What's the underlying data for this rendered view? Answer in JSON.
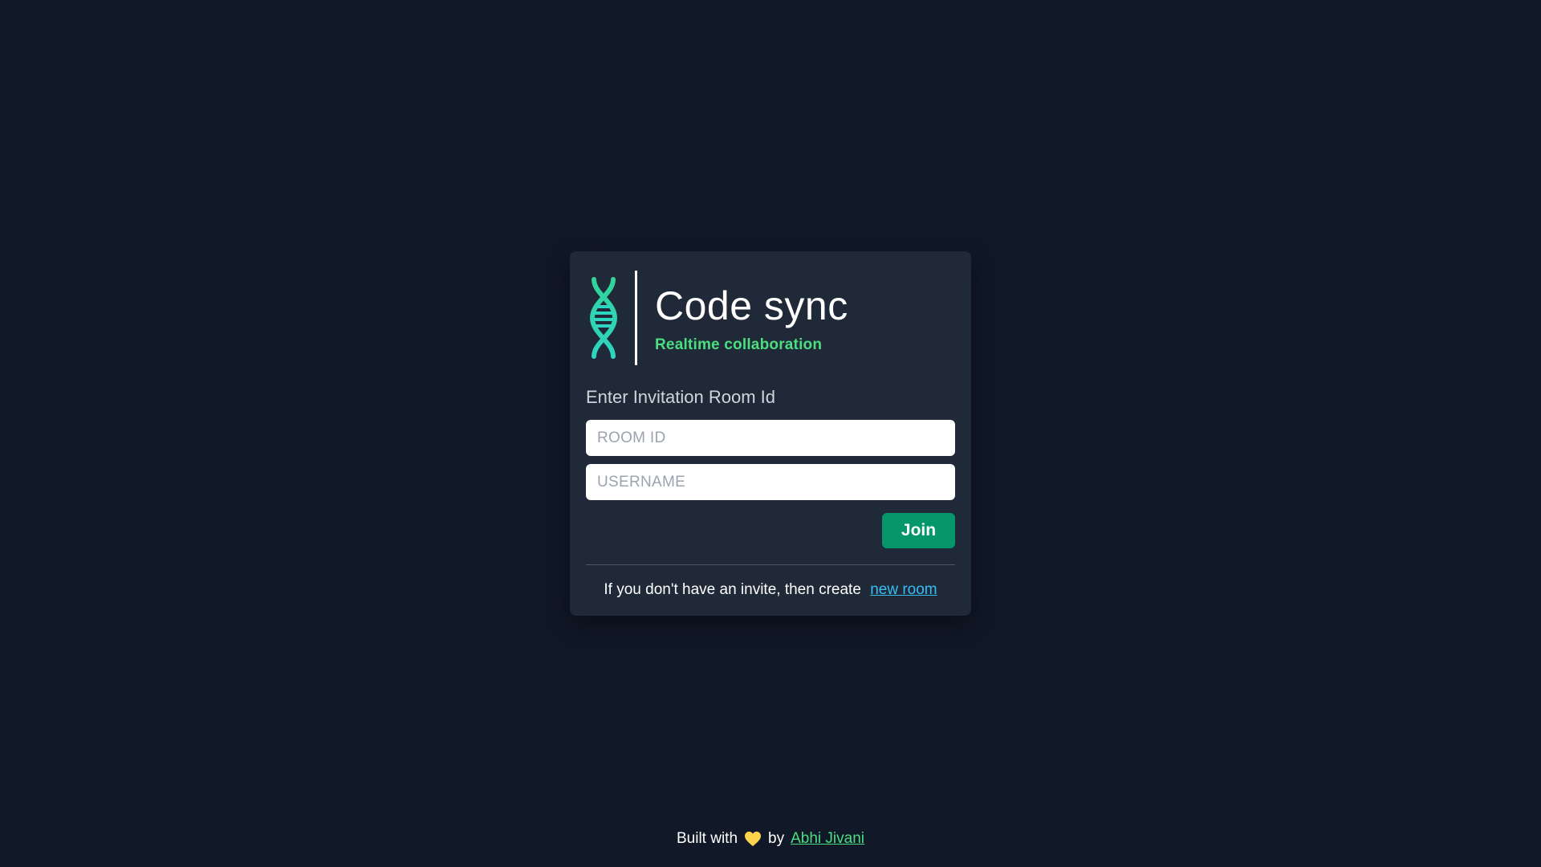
{
  "brand": {
    "title": "Code sync",
    "subtitle": "Realtime collaboration",
    "logo_icon": "dna-helix-icon"
  },
  "form": {
    "label": "Enter Invitation Room Id",
    "room_id_placeholder": "ROOM ID",
    "room_id_value": "",
    "username_placeholder": "USERNAME",
    "username_value": "",
    "join_label": "Join"
  },
  "invite": {
    "text": "If you don't have an invite, then create",
    "link_label": "new room"
  },
  "footer": {
    "built_with": "Built with",
    "heart_icon": "heart-icon",
    "by": "by",
    "author": "Abhi Jivani"
  },
  "colors": {
    "background": "#111827",
    "card": "#1f2937",
    "accent_green": "#4ade80",
    "button_green": "#059669",
    "link_blue": "#38bdf8",
    "heart_yellow": "#fcd34d"
  }
}
